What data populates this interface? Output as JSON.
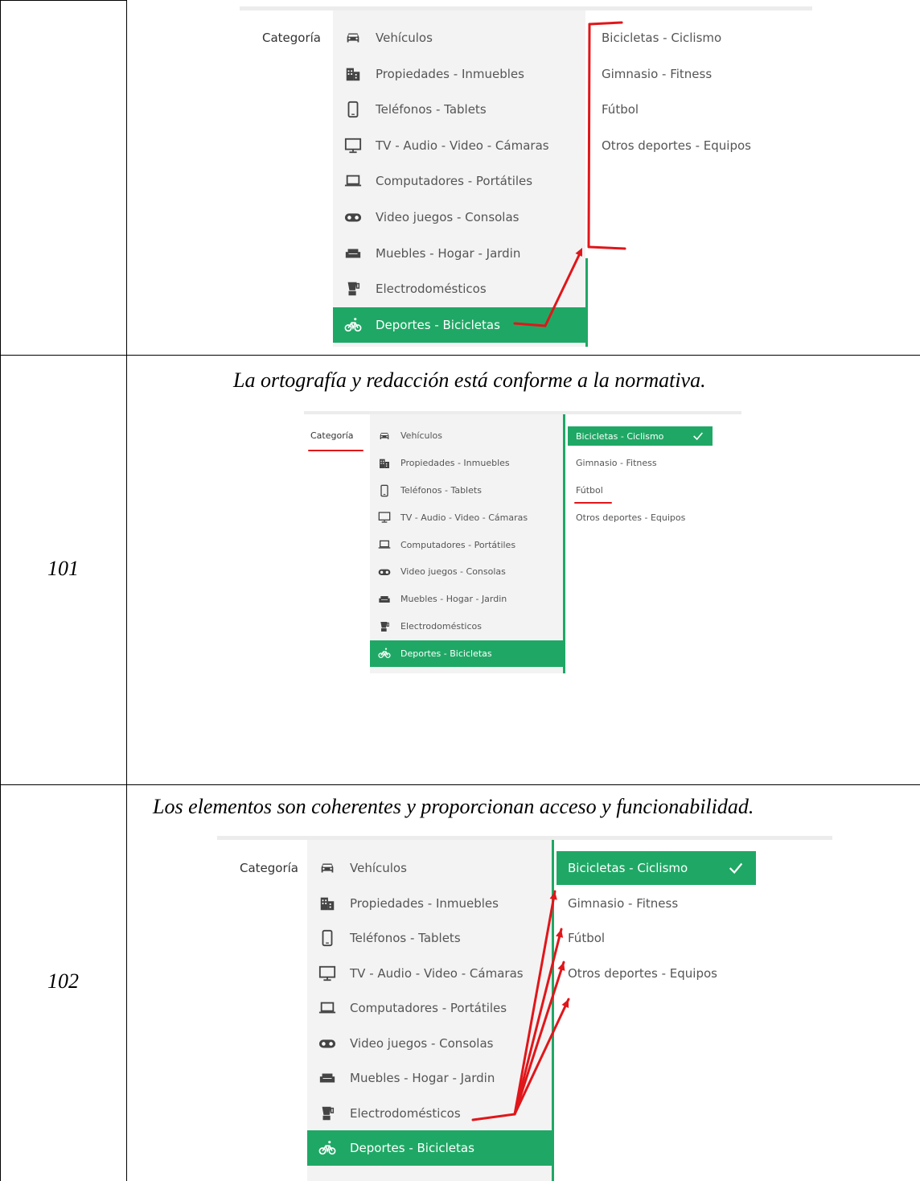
{
  "category_label": "Categoría",
  "categories": [
    {
      "label": "Vehículos",
      "icon": "car-icon"
    },
    {
      "label": "Propiedades - Inmuebles",
      "icon": "building-icon"
    },
    {
      "label": "Teléfonos - Tablets",
      "icon": "phone-icon"
    },
    {
      "label": "TV - Audio - Video - Cámaras",
      "icon": "monitor-icon"
    },
    {
      "label": "Computadores - Portátiles",
      "icon": "laptop-icon"
    },
    {
      "label": "Video juegos - Consolas",
      "icon": "gamepad-icon"
    },
    {
      "label": "Muebles - Hogar - Jardin",
      "icon": "sofa-icon"
    },
    {
      "label": "Electrodomésticos",
      "icon": "blender-icon"
    },
    {
      "label": "Deportes - Bicicletas",
      "icon": "bicycle-icon"
    }
  ],
  "subcategories": [
    {
      "label": "Bicicletas - Ciclismo"
    },
    {
      "label": "Gimnasio - Fitness"
    },
    {
      "label": "Fútbol"
    },
    {
      "label": "Otros deportes - Equipos"
    }
  ],
  "rows": [
    {
      "number": "",
      "caption": ""
    },
    {
      "number": "101",
      "caption": "La ortografía y redacción está conforme a la normativa."
    },
    {
      "number": "102",
      "caption": "Los elementos son coherentes y proporcionan acceso y funcionabilidad."
    }
  ],
  "colors": {
    "accent": "#1fa865",
    "annotation": "#e0161a",
    "panel": "#f3f3f3"
  }
}
